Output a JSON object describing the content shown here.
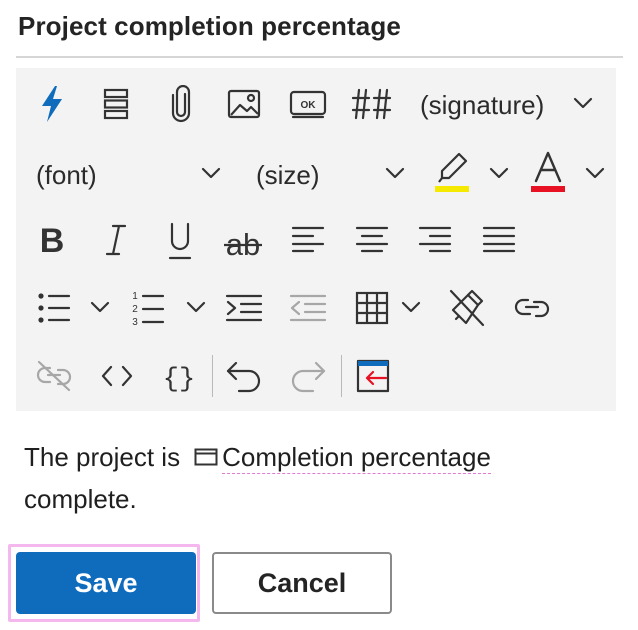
{
  "dialog": {
    "title": "Project completion percentage"
  },
  "toolbar": {
    "signature_label": "(signature)",
    "font_label": "(font)",
    "size_label": "(size)",
    "highlight_color": "#f5e900",
    "font_color": "#e81123",
    "accent_color": "#0f6cbd",
    "icons": [
      "quick-parts-icon",
      "text-block-icon",
      "attachment-icon",
      "image-icon",
      "button-icon",
      "number-icon",
      "signature-dropdown",
      "font-dropdown",
      "size-dropdown",
      "highlight-icon",
      "font-color-icon",
      "bold-icon",
      "italic-icon",
      "underline-icon",
      "strikethrough-icon",
      "align-left-icon",
      "align-center-icon",
      "align-right-icon",
      "justify-icon",
      "bullet-list-icon",
      "numbered-list-icon",
      "indent-icon",
      "outdent-icon",
      "table-icon",
      "clear-formatting-icon",
      "link-icon",
      "unlink-icon",
      "code-icon",
      "braces-icon",
      "undo-icon",
      "redo-icon",
      "insert-icon"
    ]
  },
  "content": {
    "before_text": "The project is",
    "token_label": "Completion percentage",
    "after_text": "complete."
  },
  "buttons": {
    "save_label": "Save",
    "cancel_label": "Cancel"
  }
}
